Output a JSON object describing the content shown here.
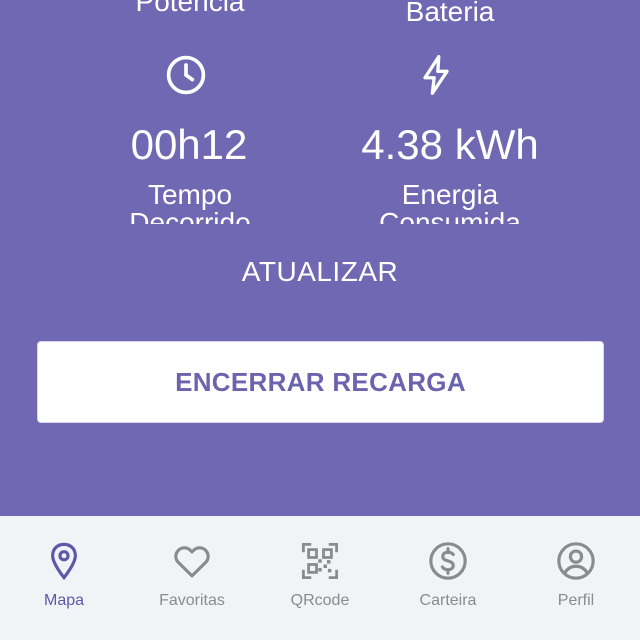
{
  "stats": {
    "potencia_label": "Potência",
    "bateria_label": "Bateria",
    "tempo_value": "00h12",
    "tempo_label_line1": "Tempo",
    "tempo_label_line2": "Decorrido",
    "energia_value": "4.38 kWh",
    "energia_label_line1": "Energia",
    "energia_label_line2": "Consumida",
    "tempo_icon": "clock-icon",
    "energia_icon": "lightning-icon"
  },
  "actions": {
    "refresh_label": "ATUALIZAR",
    "end_label": "ENCERRAR RECARGA"
  },
  "nav": {
    "items": [
      {
        "label": "Mapa",
        "icon": "map-pin-icon",
        "active": true
      },
      {
        "label": "Favoritas",
        "icon": "heart-icon",
        "active": false
      },
      {
        "label": "QRcode",
        "icon": "qrcode-icon",
        "active": false
      },
      {
        "label": "Carteira",
        "icon": "dollar-icon",
        "active": false
      },
      {
        "label": "Perfil",
        "icon": "user-icon",
        "active": false
      }
    ]
  },
  "colors": {
    "panel": "#7068b3",
    "accent": "#6b63ad",
    "nav_bg": "#f0f4f7",
    "nav_inactive": "#8b8b8b",
    "nav_active": "#5e58a8"
  }
}
